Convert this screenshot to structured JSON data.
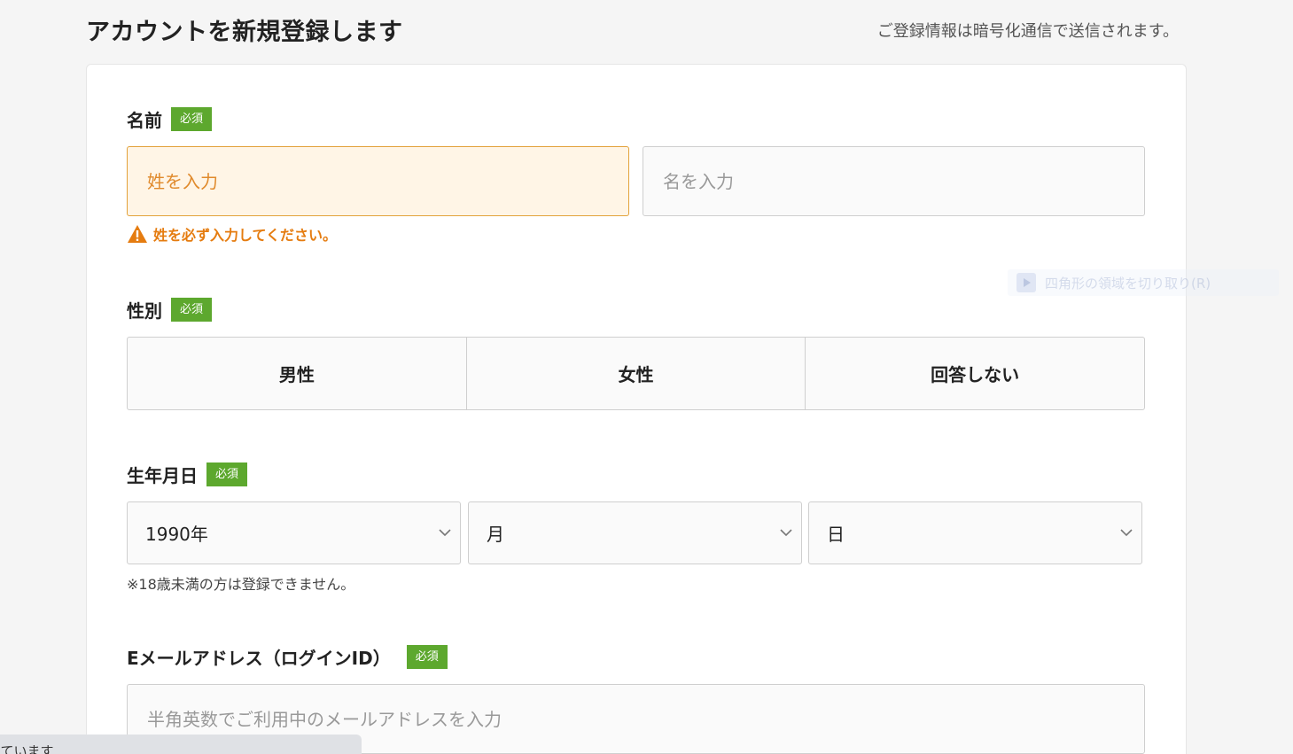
{
  "header": {
    "title": "アカウントを新規登録します",
    "secure_note": "ご登録情報は暗号化通信で送信されます。"
  },
  "form": {
    "required_badge": "必須",
    "name": {
      "label": "名前",
      "last_placeholder": "姓を入力",
      "first_placeholder": "名を入力",
      "error": "姓を必ず入力してください。"
    },
    "gender": {
      "label": "性別",
      "options": [
        "男性",
        "女性",
        "回答しない"
      ]
    },
    "birthdate": {
      "label": "生年月日",
      "year": "1990年",
      "month": "月",
      "day": "日",
      "hint": "※18歳未満の方は登録できません。"
    },
    "email": {
      "label": "Eメールアドレス（ログインID）",
      "placeholder": "半角英数でご利用中のメールアドレスを入力"
    }
  },
  "status_bar": {
    "text": "しています..."
  },
  "ghost_popup": {
    "text": "四角形の領域を切り取り(R)"
  },
  "colors": {
    "required_badge": "#5da82e",
    "error": "#e57c10",
    "error_bg": "#fff5e6"
  }
}
